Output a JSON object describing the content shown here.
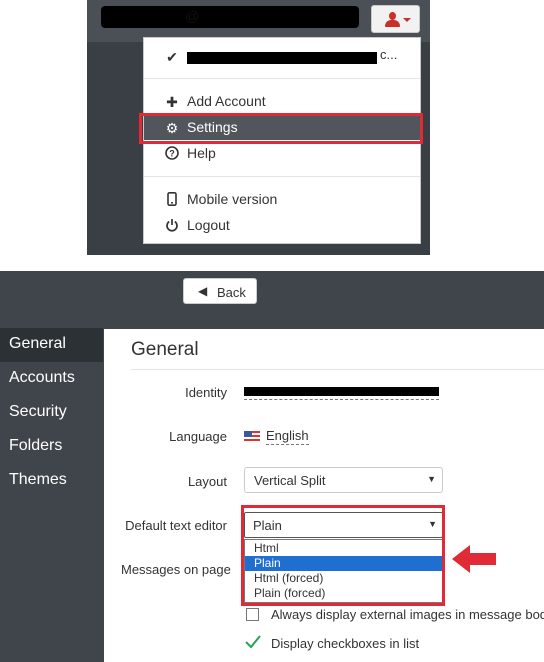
{
  "top_menu": {
    "account_visible_char": "@",
    "email_suffix": "c...",
    "items": [
      {
        "label": "Add Account",
        "icon": "plus-icon"
      },
      {
        "label": "Settings",
        "icon": "gear-icon"
      },
      {
        "label": "Help",
        "icon": "question-icon"
      },
      {
        "label": "Mobile version",
        "icon": "mobile-icon"
      },
      {
        "label": "Logout",
        "icon": "power-icon"
      }
    ]
  },
  "back_button": {
    "label": "Back"
  },
  "sidebar": {
    "items": [
      {
        "label": "General"
      },
      {
        "label": "Accounts"
      },
      {
        "label": "Security"
      },
      {
        "label": "Folders"
      },
      {
        "label": "Themes"
      }
    ]
  },
  "general": {
    "title": "General",
    "identity_label": "Identity",
    "language_label": "Language",
    "language_value": "English",
    "layout_label": "Layout",
    "layout_value": "Vertical Split",
    "editor_label": "Default text editor",
    "editor_value": "Plain",
    "editor_options": [
      "Html",
      "Plain",
      "Html (forced)",
      "Plain (forced)"
    ],
    "messages_label": "Messages on page",
    "external_images_label": "Always display external images in message body",
    "checkboxes_label": "Display checkboxes in list"
  },
  "colors": {
    "highlight": "#e02a35",
    "selected_option": "#1f6fd1",
    "sidebar_bg": "#3f454b",
    "checkmark": "#2e9e58"
  }
}
